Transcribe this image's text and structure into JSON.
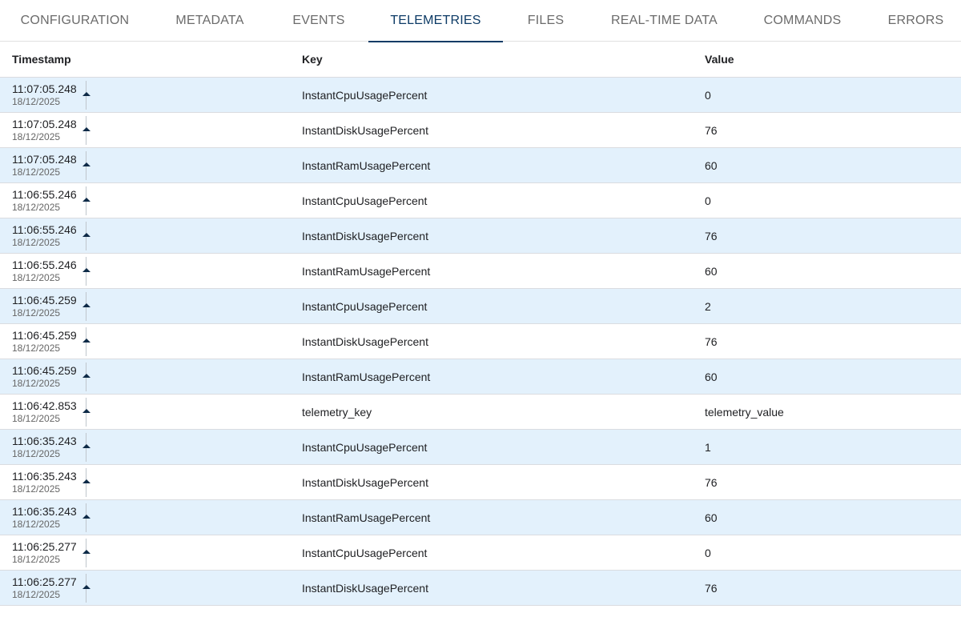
{
  "tabs": [
    {
      "label": "CONFIGURATION",
      "active": false
    },
    {
      "label": "METADATA",
      "active": false
    },
    {
      "label": "EVENTS",
      "active": false
    },
    {
      "label": "TELEMETRIES",
      "active": true
    },
    {
      "label": "FILES",
      "active": false
    },
    {
      "label": "REAL-TIME DATA",
      "active": false
    },
    {
      "label": "COMMANDS",
      "active": false
    },
    {
      "label": "ERRORS",
      "active": false
    }
  ],
  "table": {
    "headers": {
      "timestamp": "Timestamp",
      "key": "Key",
      "value": "Value"
    },
    "rows": [
      {
        "time": "11:07:05.248",
        "date": "18/12/2025",
        "key": "InstantCpuUsagePercent",
        "value": "0"
      },
      {
        "time": "11:07:05.248",
        "date": "18/12/2025",
        "key": "InstantDiskUsagePercent",
        "value": "76"
      },
      {
        "time": "11:07:05.248",
        "date": "18/12/2025",
        "key": "InstantRamUsagePercent",
        "value": "60"
      },
      {
        "time": "11:06:55.246",
        "date": "18/12/2025",
        "key": "InstantCpuUsagePercent",
        "value": "0"
      },
      {
        "time": "11:06:55.246",
        "date": "18/12/2025",
        "key": "InstantDiskUsagePercent",
        "value": "76"
      },
      {
        "time": "11:06:55.246",
        "date": "18/12/2025",
        "key": "InstantRamUsagePercent",
        "value": "60"
      },
      {
        "time": "11:06:45.259",
        "date": "18/12/2025",
        "key": "InstantCpuUsagePercent",
        "value": "2"
      },
      {
        "time": "11:06:45.259",
        "date": "18/12/2025",
        "key": "InstantDiskUsagePercent",
        "value": "76"
      },
      {
        "time": "11:06:45.259",
        "date": "18/12/2025",
        "key": "InstantRamUsagePercent",
        "value": "60"
      },
      {
        "time": "11:06:42.853",
        "date": "18/12/2025",
        "key": "telemetry_key",
        "value": "telemetry_value"
      },
      {
        "time": "11:06:35.243",
        "date": "18/12/2025",
        "key": "InstantCpuUsagePercent",
        "value": "1"
      },
      {
        "time": "11:06:35.243",
        "date": "18/12/2025",
        "key": "InstantDiskUsagePercent",
        "value": "76"
      },
      {
        "time": "11:06:35.243",
        "date": "18/12/2025",
        "key": "InstantRamUsagePercent",
        "value": "60"
      },
      {
        "time": "11:06:25.277",
        "date": "18/12/2025",
        "key": "InstantCpuUsagePercent",
        "value": "0"
      },
      {
        "time": "11:06:25.277",
        "date": "18/12/2025",
        "key": "InstantDiskUsagePercent",
        "value": "76"
      }
    ]
  },
  "colors": {
    "accent": "#0d3b66",
    "row_stripe": "#e3f1fc",
    "tab_inactive": "#6b6b6b"
  },
  "icons": {
    "row_marker": "sort-up-icon"
  }
}
